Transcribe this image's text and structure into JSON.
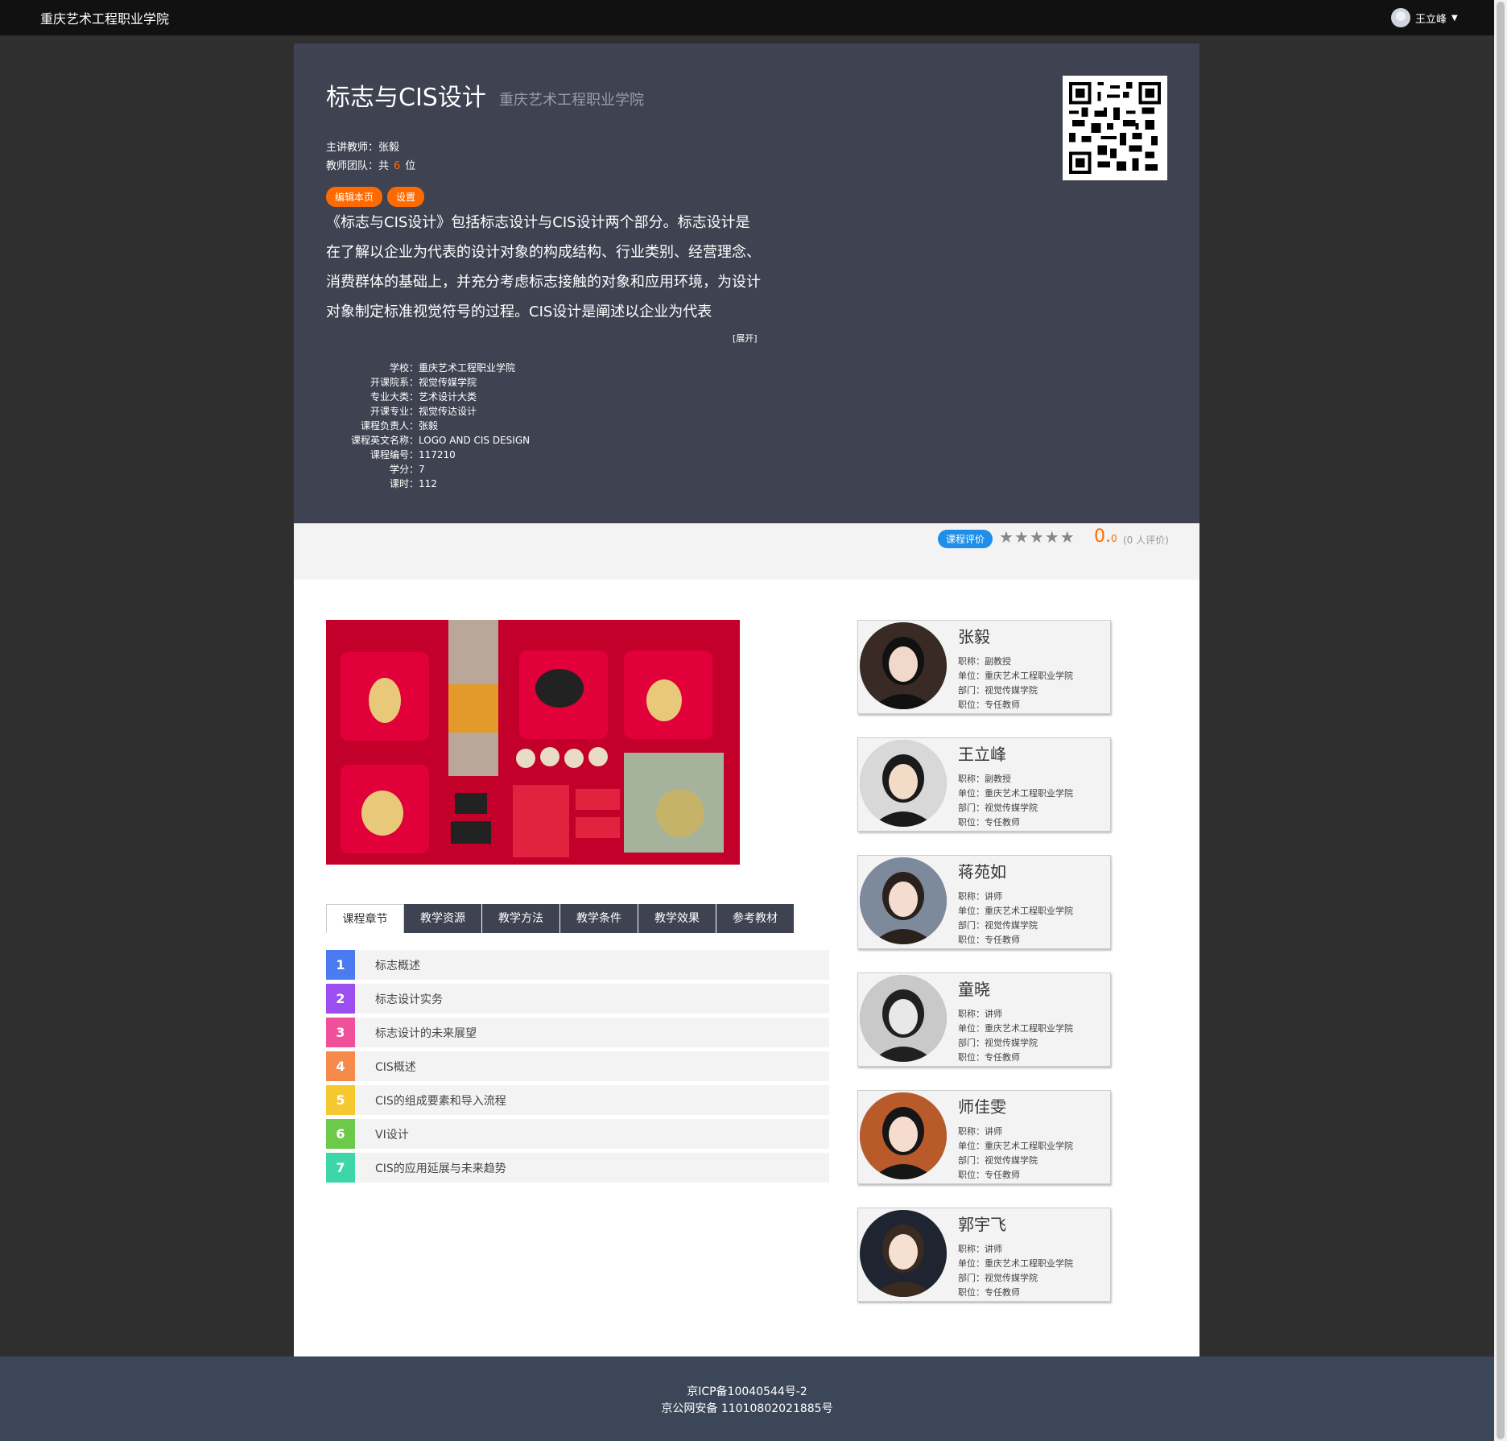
{
  "topbar": {
    "brand": "重庆艺术工程职业学院",
    "username": "王立峰"
  },
  "course": {
    "title": "标志与CIS设计",
    "school_name": "重庆艺术工程职业学院",
    "lead_teacher": "主讲教师：张毅",
    "team_prefix": "教师团队：共",
    "team_count": "6",
    "team_suffix": "位",
    "edit_label": "编辑本页",
    "settings_label": "设置",
    "description": "《标志与CIS设计》包括标志设计与CIS设计两个部分。标志设计是在了解以企业为代表的设计对象的构成结构、行业类别、经营理念、消费群体的基础上，并充分考虑标志接触的对象和应用环境，为设计对象制定标准视觉符号的过程。CIS设计是阐述以企业为代表",
    "expand_label": "[展开]",
    "info": [
      {
        "k": "学校：",
        "v": "重庆艺术工程职业学院"
      },
      {
        "k": "开课院系：",
        "v": "视觉传媒学院"
      },
      {
        "k": "专业大类：",
        "v": "艺术设计大类"
      },
      {
        "k": "开课专业：",
        "v": "视觉传达设计"
      },
      {
        "k": "课程负责人：",
        "v": "张毅"
      },
      {
        "k": "课程英文名称：",
        "v": "LOGO AND CIS DESIGN"
      },
      {
        "k": "课程编号：",
        "v": "117210"
      },
      {
        "k": "学分：",
        "v": "7"
      },
      {
        "k": "课时：",
        "v": "112"
      }
    ]
  },
  "rating": {
    "badge": "课程评价",
    "stars": "★★★★★",
    "score_int": "0.",
    "score_dec": "0",
    "count": "(0 人评价)",
    "star_count": 0
  },
  "tabs": [
    "课程章节",
    "教学资源",
    "教学方法",
    "教学条件",
    "教学效果",
    "参考教材"
  ],
  "chapters": [
    {
      "n": "1",
      "t": "标志概述",
      "color": "#4a7bf0"
    },
    {
      "n": "2",
      "t": "标志设计实务",
      "color": "#9b4ff0"
    },
    {
      "n": "3",
      "t": "标志设计的未来展望",
      "color": "#f0509a"
    },
    {
      "n": "4",
      "t": "CIS概述",
      "color": "#f58a4a"
    },
    {
      "n": "5",
      "t": "CIS的组成要素和导入流程",
      "color": "#f5c830"
    },
    {
      "n": "6",
      "t": "VI设计",
      "color": "#6cc94a"
    },
    {
      "n": "7",
      "t": "CIS的应用延展与未来趋势",
      "color": "#3ed6a8"
    }
  ],
  "teachers": [
    {
      "name": "张毅",
      "title": "职称：副教授",
      "unit": "单位：重庆艺术工程职业学院",
      "dept": "部门：视觉传媒学院",
      "post": "职位：专任教师"
    },
    {
      "name": "王立峰",
      "title": "职称：副教授",
      "unit": "单位：重庆艺术工程职业学院",
      "dept": "部门：视觉传媒学院",
      "post": "职位：专任教师"
    },
    {
      "name": "蒋苑如",
      "title": "职称：讲师",
      "unit": "单位：重庆艺术工程职业学院",
      "dept": "部门：视觉传媒学院",
      "post": "职位：专任教师"
    },
    {
      "name": "童晓",
      "title": "职称：讲师",
      "unit": "单位：重庆艺术工程职业学院",
      "dept": "部门：视觉传媒学院",
      "post": "职位：专任教师"
    },
    {
      "name": "师佳雯",
      "title": "职称：讲师",
      "unit": "单位：重庆艺术工程职业学院",
      "dept": "部门：视觉传媒学院",
      "post": "职位：专任教师"
    },
    {
      "name": "郭宇飞",
      "title": "职称：讲师",
      "unit": "单位：重庆艺术工程职业学院",
      "dept": "部门：视觉传媒学院",
      "post": "职位：专任教师"
    }
  ],
  "footer": {
    "icp": "京ICP备10040544号-2",
    "police": "京公网安备 11010802021885号"
  },
  "colors": {
    "accent": "#ff6a00",
    "header_bg": "#3f4251",
    "rating_badge": "#1e8ee8",
    "footer_bg": "#3b4659"
  }
}
